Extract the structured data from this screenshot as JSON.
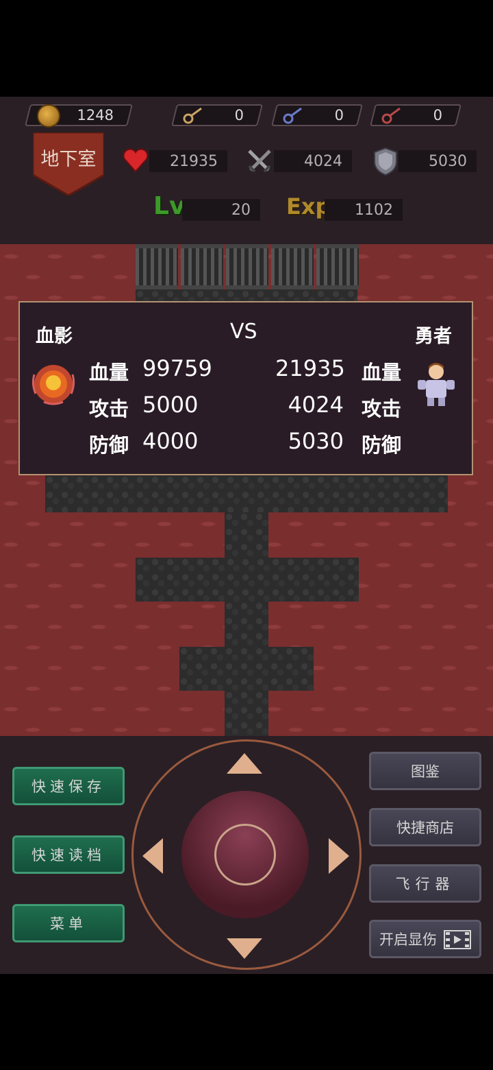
{
  "resources": {
    "gold": "1248",
    "yellow_key": "0",
    "blue_key": "0",
    "red_key": "0"
  },
  "floor_name": "地下室",
  "hero_stats": {
    "hp": "21935",
    "attack": "4024",
    "defense": "5030",
    "level_label": "Lv",
    "level": "20",
    "exp_label": "Exp",
    "exp": "1102"
  },
  "battle": {
    "enemy_name": "血影",
    "vs": "VS",
    "hero_name": "勇者",
    "hp_label": "血量",
    "atk_label": "攻击",
    "def_label": "防御",
    "enemy_hp": "99759",
    "enemy_atk": "5000",
    "enemy_def": "4000",
    "hero_hp": "21935",
    "hero_atk": "4024",
    "hero_def": "5030"
  },
  "buttons": {
    "quick_save": "快速保存",
    "quick_load": "快速读档",
    "menu": "菜单",
    "bestiary": "图鉴",
    "quick_shop": "快捷商店",
    "fly": "飞行器",
    "damage_display": "开启显伤"
  },
  "colors": {
    "map_wall": "#7a2e2e",
    "panel_border": "#b39472",
    "green_button": "#1f6e4e",
    "gray_button": "#494757"
  }
}
